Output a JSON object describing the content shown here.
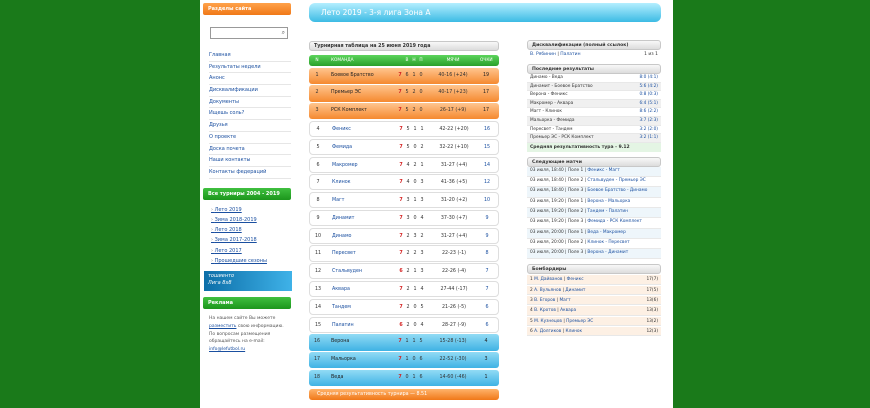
{
  "sidebar": {
    "sections_title": "Разделы сайта",
    "menu": [
      "Главная",
      "Результаты недели",
      "Анонс",
      "Дисквалификации",
      "Документы",
      "Ищешь соль?",
      "Друзья",
      "О проекте",
      "Доска почета",
      "Наши контакты",
      "Контакты федераций"
    ],
    "tournaments_title": "Все турниры 2004 - 2019",
    "tournaments": [
      "Лето 2019",
      "Зима 2018-2019",
      "Лето 2018",
      "Зима 2017-2018",
      "Лето 2017",
      "Прошедшие сезоны"
    ],
    "banner_text": "тошиенто",
    "banner_sub": "Лига 8x8",
    "ads_title": "Реклама",
    "ad_text_1": "На нашем сайте Вы можете",
    "ad_link": "разместить",
    "ad_text_2": "свою информацию. По вопросам размещения обращайтесь на e-mail:",
    "ad_email": "info@lefutbol.ru"
  },
  "title_bar": "Лето 2019 - 3-я лига Зона А",
  "standings": {
    "title": "Турнирная таблица на 25 июня 2019 года",
    "headers": {
      "n": "N",
      "team": "КОМАНДА",
      "w": "В",
      "d": "Н",
      "l": "П",
      "g": "",
      "goals": "МЯЧИ",
      "pts": "ОЧКИ"
    },
    "rows": [
      {
        "n": "1",
        "team": "Боевое Братство",
        "g": "7",
        "w": "6",
        "d": "1",
        "l": "0",
        "goals": "40-16 (+24)",
        "pts": "19",
        "zone": "promo"
      },
      {
        "n": "2",
        "team": "Премьер ЭС",
        "g": "7",
        "w": "5",
        "d": "2",
        "l": "0",
        "goals": "40-17 (+23)",
        "pts": "17",
        "zone": "promo"
      },
      {
        "n": "3",
        "team": "РСК Комплект",
        "g": "7",
        "w": "5",
        "d": "2",
        "l": "0",
        "goals": "26-17 (+9)",
        "pts": "17",
        "zone": "promo"
      },
      {
        "n": "4",
        "team": "Феникс",
        "g": "7",
        "w": "5",
        "d": "1",
        "l": "1",
        "goals": "42-22 (+20)",
        "pts": "16",
        "zone": "mid"
      },
      {
        "n": "5",
        "team": "Фемида",
        "g": "7",
        "w": "5",
        "d": "0",
        "l": "2",
        "goals": "32-22 (+10)",
        "pts": "15",
        "zone": "mid"
      },
      {
        "n": "6",
        "team": "Макромер",
        "g": "7",
        "w": "4",
        "d": "2",
        "l": "1",
        "goals": "31-27 (+4)",
        "pts": "14",
        "zone": "mid"
      },
      {
        "n": "7",
        "team": "Клинок",
        "g": "7",
        "w": "4",
        "d": "0",
        "l": "3",
        "goals": "41-36 (+5)",
        "pts": "12",
        "zone": "mid"
      },
      {
        "n": "8",
        "team": "Магт",
        "g": "7",
        "w": "3",
        "d": "1",
        "l": "3",
        "goals": "31-20 (+2)",
        "pts": "10",
        "zone": "mid"
      },
      {
        "n": "9",
        "team": "Динамит",
        "g": "7",
        "w": "3",
        "d": "0",
        "l": "4",
        "goals": "37-30 (+7)",
        "pts": "9",
        "zone": "mid"
      },
      {
        "n": "10",
        "team": "Динамо",
        "g": "7",
        "w": "2",
        "d": "3",
        "l": "2",
        "goals": "31-27 (+4)",
        "pts": "9",
        "zone": "mid"
      },
      {
        "n": "11",
        "team": "Пересвет",
        "g": "7",
        "w": "2",
        "d": "2",
        "l": "3",
        "goals": "22-23 (-1)",
        "pts": "8",
        "zone": "mid"
      },
      {
        "n": "12",
        "team": "Стальвуден",
        "g": "6",
        "w": "2",
        "d": "1",
        "l": "3",
        "goals": "22-26 (-4)",
        "pts": "7",
        "zone": "mid"
      },
      {
        "n": "13",
        "team": "Аквара",
        "g": "7",
        "w": "2",
        "d": "1",
        "l": "4",
        "goals": "27-44 (-17)",
        "pts": "7",
        "zone": "mid"
      },
      {
        "n": "14",
        "team": "Тандем",
        "g": "7",
        "w": "2",
        "d": "0",
        "l": "5",
        "goals": "21-26 (-5)",
        "pts": "6",
        "zone": "mid"
      },
      {
        "n": "15",
        "team": "Палатин",
        "g": "6",
        "w": "2",
        "d": "0",
        "l": "4",
        "goals": "28-27 (-9)",
        "pts": "6",
        "zone": "mid"
      },
      {
        "n": "16",
        "team": "Верона",
        "g": "7",
        "w": "1",
        "d": "1",
        "l": "5",
        "goals": "15-28 (-13)",
        "pts": "4",
        "zone": "releg"
      },
      {
        "n": "17",
        "team": "Мальорка",
        "g": "7",
        "w": "1",
        "d": "0",
        "l": "6",
        "goals": "22-52 (-30)",
        "pts": "3",
        "zone": "releg"
      },
      {
        "n": "18",
        "team": "Веда",
        "g": "7",
        "w": "0",
        "d": "1",
        "l": "6",
        "goals": "14-60 (-46)",
        "pts": "1",
        "zone": "releg"
      }
    ],
    "footer": "Средняя результативность турнира — 8.51"
  },
  "disq": {
    "title": "Дисквалификации (полный ссылок)",
    "player": "В. Рябинин",
    "team": "Палатин",
    "games": "1 из 1"
  },
  "results": {
    "title": "Последние результаты",
    "items": [
      {
        "m": "Динамо - Веда",
        "s": "8:0 (4:1)"
      },
      {
        "m": "Динамит - Боевое Братство",
        "s": "5:6 (4:2)"
      },
      {
        "m": "Верона - Феникс",
        "s": "0:8 (0:3)"
      },
      {
        "m": "Макромер - Аквара",
        "s": "6:4 (5:1)"
      },
      {
        "m": "Магт - Клинок",
        "s": "8:6 (2:2)"
      },
      {
        "m": "Мальорка - Фемида",
        "s": "3:7 (2:3)"
      },
      {
        "m": "Пересвет - Тандем",
        "s": "3:2 (2:0)"
      },
      {
        "m": "Премьер ЭС - РСК Комплект",
        "s": "3:2 (1:1)"
      }
    ],
    "footer": "Средняя результативность тура - 9.12"
  },
  "upcoming": {
    "title": "Следующие матчи",
    "items": [
      {
        "d": "03 июля, 18:40 | Поле 1 |",
        "t": "Феникс - Магт"
      },
      {
        "d": "03 июля, 18:40 | Поле 2 |",
        "t": "Стальвуден - Премьер ЭС"
      },
      {
        "d": "03 июля, 18:40 | Поле 3 |",
        "t": "Боевое Братство - Динамо"
      },
      {
        "d": "03 июля, 19:20 | Поле 1 |",
        "t": "Верона - Мальорка"
      },
      {
        "d": "03 июля, 19:20 | Поле 2 |",
        "t": "Тандем - Палатин"
      },
      {
        "d": "03 июля, 19:20 | Поле 3 |",
        "t": "Фемида - РСК Комплект"
      },
      {
        "d": "03 июля, 20:00 | Поле 1 |",
        "t": "Веда - Макромер"
      },
      {
        "d": "03 июля, 20:00 | Поле 2 |",
        "t": "Клинок - Пересвет"
      },
      {
        "d": "03 июля, 20:00 | Поле 3 |",
        "t": "Верона - Динамит"
      }
    ]
  },
  "scorers": {
    "title": "Бомбардиры",
    "items": [
      {
        "n": "1",
        "name": "М. Дайванов",
        "team": "Феникс",
        "g": "17(7)"
      },
      {
        "n": "2",
        "name": "А. Вульянов",
        "team": "Динамит",
        "g": "17(5)"
      },
      {
        "n": "3",
        "name": "В. Егоров",
        "team": "Магт",
        "g": "13(6)"
      },
      {
        "n": "4",
        "name": "В. Кротов",
        "team": "Аквара",
        "g": "13(3)"
      },
      {
        "n": "5",
        "name": "М. Кузнецов",
        "team": "Премьер ЭС",
        "g": "13(2)"
      },
      {
        "n": "6",
        "name": "А. Долгиков",
        "team": "Клинок",
        "g": "12(3)"
      }
    ]
  }
}
